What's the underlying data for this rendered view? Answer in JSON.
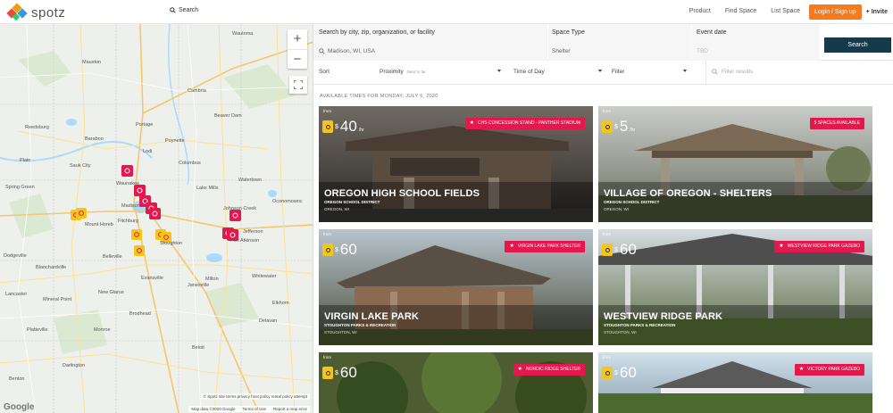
{
  "header": {
    "logo_text": "spotz",
    "search_label": "Search",
    "nav": [
      "Product",
      "Find Space",
      "List Space"
    ],
    "login_label": "Login / Sign up",
    "invite_label": "Invite"
  },
  "search": {
    "location_label": "Search by city, zip, organization, or facility",
    "location_value": "Madison, WI, USA",
    "space_type_label": "Space Type",
    "space_type_value": "Shelter",
    "event_date_label": "Event date",
    "event_date_placeholder": "TBD",
    "search_button": "Search"
  },
  "filters": {
    "sort_label": "Sort",
    "sort_value": "Proximity",
    "sort_hint": "Near to far",
    "time_of_day": "Time of Day",
    "filter": "Filter",
    "filter_results_placeholder": "Filter results"
  },
  "available_times": "AVAILABLE TIMES FOR MONDAY, JULY 6, 2020",
  "map": {
    "attribution": "© Spotz   site terms   privacy   host policy   rental policy   attempt",
    "map_data": "Map data ©2020 Google",
    "terms": "Terms of Use",
    "report": "Report a map error",
    "google": "Google",
    "towns": [
      "Madison",
      "Waunakee",
      "Fitchburg",
      "Stoughton",
      "Fort Atkinson",
      "Johnson Creek",
      "Beaver Dam",
      "Portage",
      "Baraboo",
      "Reedsburg",
      "Janesville",
      "Monroe",
      "Dodgeville",
      "Mount Horeb",
      "Sauk City",
      "Lake Mills",
      "Watertown",
      "Oconomowoc",
      "Spring Green",
      "Platteville",
      "Lancaster",
      "Blanchardville",
      "Evansville",
      "Milton",
      "Whitewater",
      "Beloit",
      "Brodhead",
      "Delavan",
      "Elkhorn",
      "Mauston",
      "Cambria",
      "Columbus",
      "Poynette",
      "Lodi",
      "Wautoma",
      "Plain",
      "Jefferson",
      "Belleville",
      "New Glarus",
      "Darlington",
      "Benton",
      "Mineral Point"
    ]
  },
  "cards": [
    {
      "from": "from",
      "price": "40",
      "per": "/hr",
      "badge": "CHS CONCESSION STAND - PANTHER STADIUM",
      "title": "OREGON HIGH SCHOOL FIELDS",
      "org": "OREGON SCHOOL DISTRICT",
      "location": "OREGON, WI"
    },
    {
      "from": "from",
      "price": "5",
      "per": "/hr",
      "badge": "5 SPACES AVAILABLE",
      "title": "VILLAGE OF OREGON - SHELTERS",
      "org": "OREGON SCHOOL DISTRICT",
      "location": "OREGON, WI"
    },
    {
      "from": "from",
      "price": "60",
      "per": "",
      "badge": "VIRGIN LAKE PARK SHELTER",
      "title": "VIRGIN LAKE PARK",
      "org": "STOUGHTON PARKS & RECREATION",
      "location": "STOUGHTON, WI"
    },
    {
      "from": "from",
      "price": "60",
      "per": "",
      "badge": "WESTVIEW RIDGE PARK GAZEBO",
      "title": "WESTVIEW RIDGE PARK",
      "org": "STOUGHTON PARKS & RECREATION",
      "location": "STOUGHTON, WI"
    },
    {
      "from": "from",
      "price": "60",
      "per": "",
      "badge": "NORDIC RIDGE SHELTER",
      "title": "",
      "org": "",
      "location": ""
    },
    {
      "from": "from",
      "price": "60",
      "per": "",
      "badge": "VICTORY PARK GAZEBO",
      "title": "",
      "org": "",
      "location": ""
    }
  ],
  "colors": {
    "accent_orange": "#f47b20",
    "search_button": "#153b4b",
    "badge_red": "#e5174d",
    "pin_yellow": "#f5c518"
  }
}
